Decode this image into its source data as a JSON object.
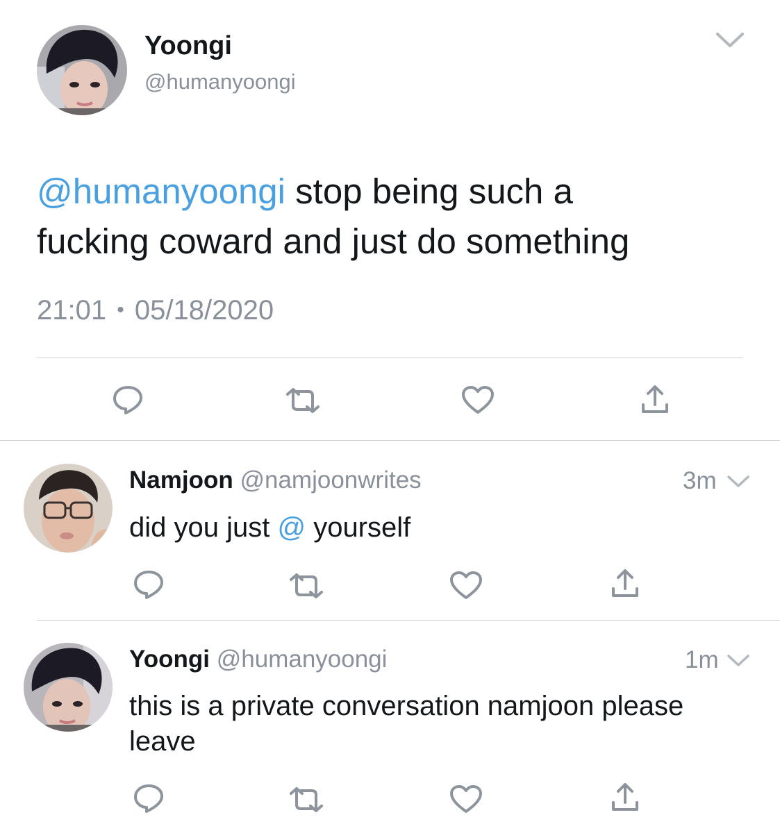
{
  "main_tweet": {
    "author": {
      "name": "Yoongi",
      "handle": "@humanyoongi",
      "avatar_icon": "avatar-yoongi"
    },
    "menu_icon": "chevron-down-icon",
    "text": {
      "mention": "@humanyoongi",
      "line1_rest": " stop being such a",
      "line2": "fucking coward and just do something"
    },
    "time": "21:01",
    "separator": "•",
    "date": "05/18/2020"
  },
  "replies": [
    {
      "author": {
        "name": "Namjoon",
        "handle": "@namjoonwrites",
        "avatar_icon": "avatar-namjoon"
      },
      "age": "3m",
      "text": {
        "before": "did you just ",
        "mention": "@",
        "after": " yourself"
      }
    },
    {
      "author": {
        "name": "Yoongi",
        "handle": "@humanyoongi",
        "avatar_icon": "avatar-yoongi"
      },
      "age": "1m",
      "text": {
        "line1": "this is a private conversation namjoon please",
        "line2": "leave"
      }
    }
  ],
  "actions": [
    "reply-icon",
    "retweet-icon",
    "like-icon",
    "share-icon"
  ],
  "colors": {
    "link": "#4aa0df",
    "muted": "#8a9099",
    "icon": "#8d949c",
    "divider": "#cfd3d7"
  }
}
